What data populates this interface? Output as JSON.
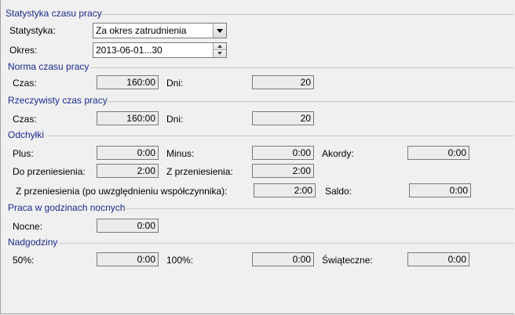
{
  "sections": {
    "statystyka": "Statystyka czasu pracy",
    "norma": "Norma czasu pracy",
    "rzeczywisty": "Rzeczywisty czas pracy",
    "odchylki": "Odchyłki",
    "nocne": "Praca w godzinach nocnych",
    "nadgodziny": "Nadgodziny"
  },
  "header": {
    "statystyka_label": "Statystyka:",
    "statystyka_value": "Za okres zatrudnienia",
    "okres_label": "Okres:",
    "okres_value": "2013-06-01...30"
  },
  "norma": {
    "czas_label": "Czas:",
    "czas": "160:00",
    "dni_label": "Dni:",
    "dni": "20"
  },
  "rzeczywisty": {
    "czas_label": "Czas:",
    "czas": "160:00",
    "dni_label": "Dni:",
    "dni": "20"
  },
  "odchylki": {
    "plus_label": "Plus:",
    "plus": "0:00",
    "minus_label": "Minus:",
    "minus": "0:00",
    "akordy_label": "Akordy:",
    "akordy": "0:00",
    "do_label": "Do przeniesienia:",
    "do": "2:00",
    "z_label": "Z przeniesienia:",
    "z": "2:00",
    "zw_label": "Z przeniesienia (po uwzględnieniu współczynnika):",
    "zw": "2:00",
    "saldo_label": "Saldo:",
    "saldo": "0:00"
  },
  "nocne": {
    "label": "Nocne:",
    "value": "0:00"
  },
  "nadgodziny": {
    "p50_label": "50%:",
    "p50": "0:00",
    "p100_label": "100%:",
    "p100": "0:00",
    "swiateczne_label": "Świąteczne:",
    "swiateczne": "0:00"
  }
}
